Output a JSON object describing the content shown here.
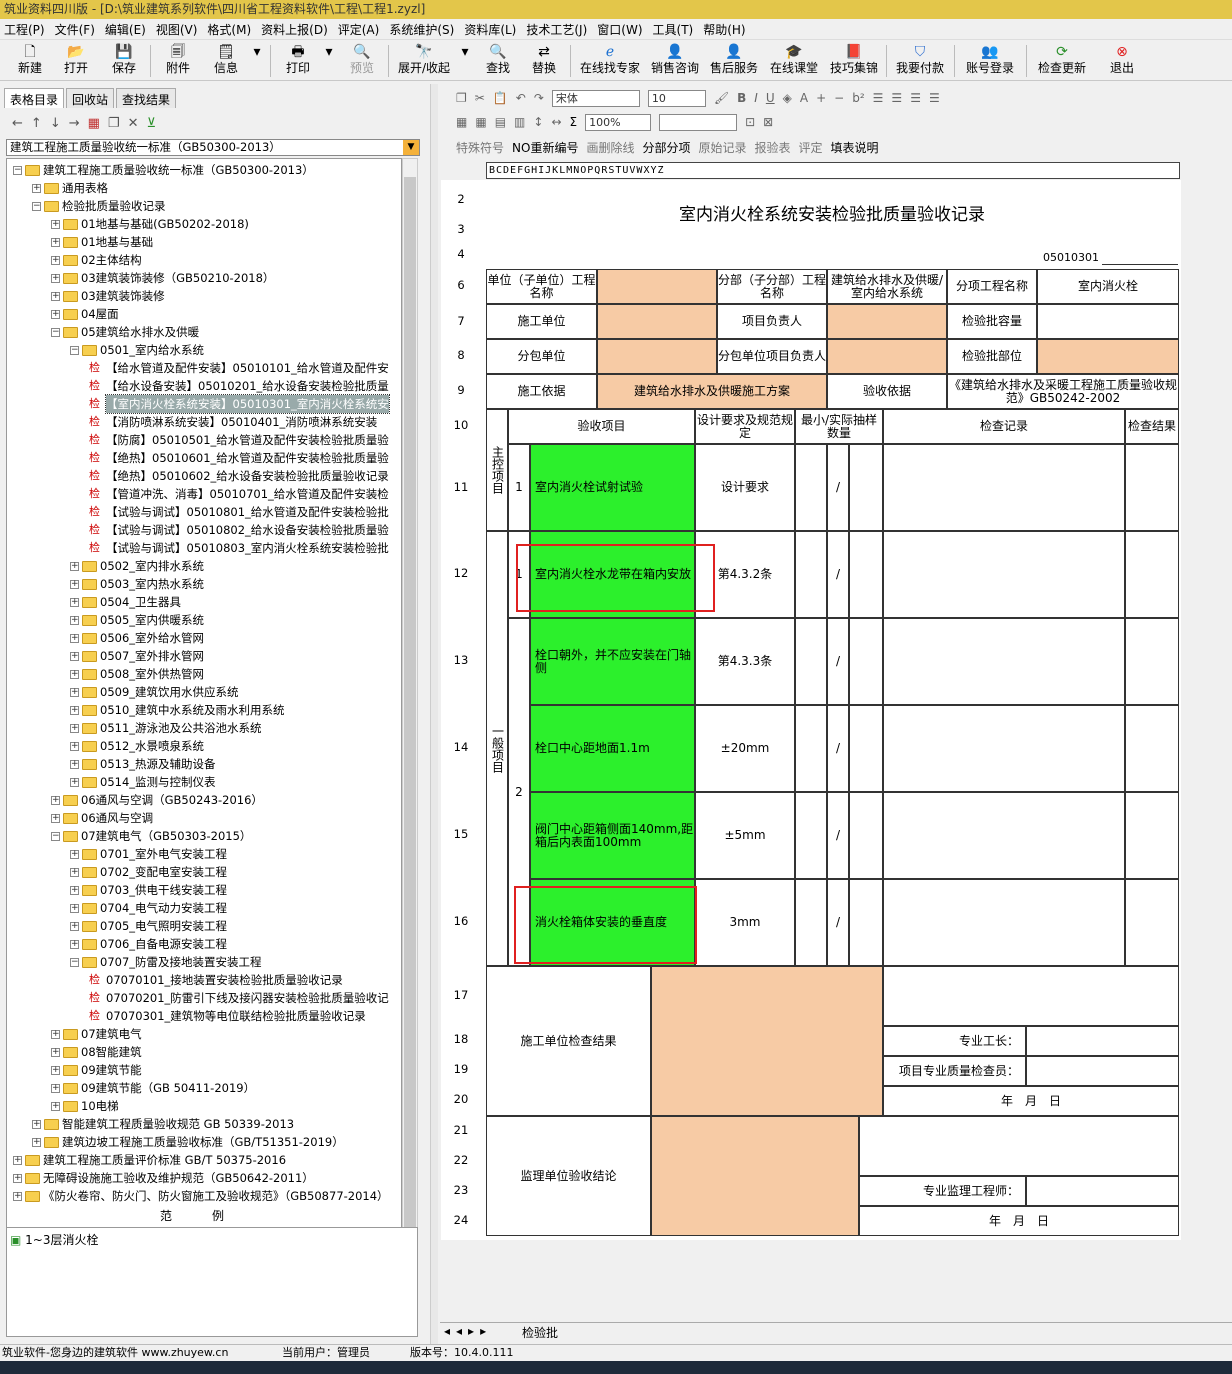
{
  "window": {
    "title": "筑业资料四川版 - [D:\\筑业建筑系列软件\\四川省工程资料软件\\工程\\工程1.zyzl]"
  },
  "menu": [
    "工程(P)",
    "文件(F)",
    "编辑(E)",
    "视图(V)",
    "格式(M)",
    "资料上报(D)",
    "评定(A)",
    "系统维护(S)",
    "资料库(L)",
    "技术工艺(J)",
    "窗口(W)",
    "工具(T)",
    "帮助(H)"
  ],
  "toolbar": {
    "new": "新建",
    "open": "打开",
    "save": "保存",
    "attach": "附件",
    "info": "信息",
    "print": "打印",
    "preview": "预览",
    "expand": "展开/收起",
    "find": "查找",
    "replace": "替换",
    "expert": "在线找专家",
    "consult": "销售咨询",
    "service": "售后服务",
    "course": "在线课堂",
    "tips": "技巧集锦",
    "pay": "我要付款",
    "login": "账号登录",
    "update": "检查更新",
    "exit": "退出"
  },
  "left_tabs": [
    "表格目录",
    "回收站",
    "查找结果"
  ],
  "std_select": "建筑工程施工质量验收统一标准（GB50300-2013）",
  "tree": [
    {
      "d": 0,
      "t": "建筑工程施工质量验收统一标准（GB50300-2013）",
      "k": "o"
    },
    {
      "d": 1,
      "t": "通用表格",
      "k": "f"
    },
    {
      "d": 1,
      "t": "检验批质量验收记录",
      "k": "o"
    },
    {
      "d": 2,
      "t": "01地基与基础(GB50202-2018)",
      "k": "f"
    },
    {
      "d": 2,
      "t": "01地基与基础",
      "k": "f"
    },
    {
      "d": 2,
      "t": "02主体结构",
      "k": "f"
    },
    {
      "d": 2,
      "t": "03建筑装饰装修（GB50210-2018）",
      "k": "f"
    },
    {
      "d": 2,
      "t": "03建筑装饰装修",
      "k": "f"
    },
    {
      "d": 2,
      "t": "04屋面",
      "k": "f"
    },
    {
      "d": 2,
      "t": "05建筑给水排水及供暖",
      "k": "o"
    },
    {
      "d": 3,
      "t": "0501_室内给水系统",
      "k": "o"
    },
    {
      "d": 4,
      "t": "【给水管道及配件安装】05010101_给水管道及配件安",
      "k": "j"
    },
    {
      "d": 4,
      "t": "【给水设备安装】05010201_给水设备安装检验批质量",
      "k": "j"
    },
    {
      "d": 4,
      "t": "【室内消火栓系统安装】05010301_室内消火栓系统安",
      "k": "js"
    },
    {
      "d": 4,
      "t": "【消防喷淋系统安装】05010401_消防喷淋系统安装",
      "k": "j"
    },
    {
      "d": 4,
      "t": "【防腐】05010501_给水管道及配件安装检验批质量验",
      "k": "j"
    },
    {
      "d": 4,
      "t": "【绝热】05010601_给水管道及配件安装检验批质量验",
      "k": "j"
    },
    {
      "d": 4,
      "t": "【绝热】05010602_给水设备安装检验批质量验收记录",
      "k": "j"
    },
    {
      "d": 4,
      "t": "【管道冲洗、消毒】05010701_给水管道及配件安装检",
      "k": "j"
    },
    {
      "d": 4,
      "t": "【试验与调试】05010801_给水管道及配件安装检验批",
      "k": "j"
    },
    {
      "d": 4,
      "t": "【试验与调试】05010802_给水设备安装检验批质量验",
      "k": "j"
    },
    {
      "d": 4,
      "t": "【试验与调试】05010803_室内消火栓系统安装检验批",
      "k": "j"
    },
    {
      "d": 3,
      "t": "0502_室内排水系统",
      "k": "f"
    },
    {
      "d": 3,
      "t": "0503_室内热水系统",
      "k": "f"
    },
    {
      "d": 3,
      "t": "0504_卫生器具",
      "k": "f"
    },
    {
      "d": 3,
      "t": "0505_室内供暖系统",
      "k": "f"
    },
    {
      "d": 3,
      "t": "0506_室外给水管网",
      "k": "f"
    },
    {
      "d": 3,
      "t": "0507_室外排水管网",
      "k": "f"
    },
    {
      "d": 3,
      "t": "0508_室外供热管网",
      "k": "f"
    },
    {
      "d": 3,
      "t": "0509_建筑饮用水供应系统",
      "k": "f"
    },
    {
      "d": 3,
      "t": "0510_建筑中水系统及雨水利用系统",
      "k": "f"
    },
    {
      "d": 3,
      "t": "0511_游泳池及公共浴池水系统",
      "k": "f"
    },
    {
      "d": 3,
      "t": "0512_水景喷泉系统",
      "k": "f"
    },
    {
      "d": 3,
      "t": "0513_热源及辅助设备",
      "k": "f"
    },
    {
      "d": 3,
      "t": "0514_监测与控制仪表",
      "k": "f"
    },
    {
      "d": 2,
      "t": "06通风与空调（GB50243-2016）",
      "k": "f"
    },
    {
      "d": 2,
      "t": "06通风与空调",
      "k": "f"
    },
    {
      "d": 2,
      "t": "07建筑电气（GB50303-2015）",
      "k": "o"
    },
    {
      "d": 3,
      "t": "0701_室外电气安装工程",
      "k": "f"
    },
    {
      "d": 3,
      "t": "0702_变配电室安装工程",
      "k": "f"
    },
    {
      "d": 3,
      "t": "0703_供电干线安装工程",
      "k": "f"
    },
    {
      "d": 3,
      "t": "0704_电气动力安装工程",
      "k": "f"
    },
    {
      "d": 3,
      "t": "0705_电气照明安装工程",
      "k": "f"
    },
    {
      "d": 3,
      "t": "0706_自备电源安装工程",
      "k": "f"
    },
    {
      "d": 3,
      "t": "0707_防雷及接地装置安装工程",
      "k": "o"
    },
    {
      "d": 4,
      "t": "07070101_接地装置安装检验批质量验收记录",
      "k": "j"
    },
    {
      "d": 4,
      "t": "07070201_防雷引下线及接闪器安装检验批质量验收记",
      "k": "j"
    },
    {
      "d": 4,
      "t": "07070301_建筑物等电位联结检验批质量验收记录",
      "k": "j"
    },
    {
      "d": 2,
      "t": "07建筑电气",
      "k": "f"
    },
    {
      "d": 2,
      "t": "08智能建筑",
      "k": "f"
    },
    {
      "d": 2,
      "t": "09建筑节能",
      "k": "f"
    },
    {
      "d": 2,
      "t": "09建筑节能（GB 50411-2019）",
      "k": "f"
    },
    {
      "d": 2,
      "t": "10电梯",
      "k": "f"
    },
    {
      "d": 1,
      "t": "智能建筑工程质量验收规范 GB 50339-2013",
      "k": "f"
    },
    {
      "d": 1,
      "t": "建筑边坡工程施工质量验收标准（GB/T51351-2019）",
      "k": "f"
    },
    {
      "d": 0,
      "t": "建筑工程施工质量评价标准 GB/T 50375-2016",
      "k": "f"
    },
    {
      "d": 0,
      "t": "无障碍设施施工验收及维护规范（GB50642-2011）",
      "k": "f"
    },
    {
      "d": 0,
      "t": "《防火卷帘、防火门、防火窗施工及验收规范》（GB50877-2014）",
      "k": "f"
    }
  ],
  "example_header": "范例",
  "example_item": "1~3层消火栓",
  "rt1": [
    "宋体",
    "10",
    "100%"
  ],
  "rt3": {
    "special": "特殊符号",
    "renumber": "NO重新编号",
    "delete_line": "画删除线",
    "item_split": "分部分项",
    "orig": "原始记录",
    "report": "报验表",
    "eval": "评定",
    "fill_help": "填表说明"
  },
  "col_header": "BCDEFGHIJKLMNOPQRSTUVWXYZ",
  "form": {
    "title": "室内消火栓系统安装检验批质量验收记录",
    "code": "05010301",
    "unit_label": "单位（子单位）工程名称",
    "sub_label": "分部（子分部）工程名称",
    "sub_val": "建筑给水排水及供暖/室内给水系统",
    "item_label": "分项工程名称",
    "item_val": "室内消火栓",
    "constr_label": "施工单位",
    "pm_label": "项目负责人",
    "cap_label": "检验批容量",
    "subc_label": "分包单位",
    "subpm_label": "分包单位项目负责人",
    "part_label": "检验批部位",
    "basis_label": "施工依据",
    "basis_val": "建筑给水排水及供暖施工方案",
    "acc_label": "验收依据",
    "acc_val": "《建筑给水排水及采暖工程施工质量验收规范》GB50242-2002",
    "h_item": "验收项目",
    "h_design": "设计要求及规范规定",
    "h_min": "最小/实际抽样数量",
    "h_record": "检查记录",
    "h_result": "检查结果",
    "main_label": "主控项目",
    "general_label": "一般项目",
    "rows": [
      {
        "n": "1",
        "item": "室内消火栓试射试验",
        "req": "设计要求",
        "slash": "/"
      },
      {
        "n": "1",
        "item": "室内消火栓水龙带在箱内安放",
        "req": "第4.3.2条",
        "slash": "/"
      },
      {
        "n": "",
        "item": "栓口朝外，并不应安装在门轴侧",
        "req": "第4.3.3条",
        "slash": "/"
      },
      {
        "n": "",
        "item": "栓口中心距地面1.1m",
        "req": "±20mm",
        "slash": "/"
      },
      {
        "n": "",
        "item": "阀门中心距箱侧面140mm,距箱后内表面100mm",
        "req": "±5mm",
        "slash": "/"
      },
      {
        "n": "",
        "item": "消火栓箱体安装的垂直度",
        "req": "3mm",
        "slash": "/"
      }
    ],
    "general_n": "2",
    "constr_result": "施工单位检查结果",
    "foreman": "专业工长：",
    "inspector": "项目专业质量检查员：",
    "date": "年　月　日",
    "sup_result": "监理单位验收结论",
    "sup_eng": "专业监理工程师：",
    "row_nums": [
      "2",
      "3",
      "4",
      "6",
      "7",
      "8",
      "9",
      "10",
      "11",
      "12",
      "13",
      "14",
      "15",
      "16",
      "17",
      "18",
      "19",
      "20",
      "21",
      "22",
      "23",
      "24"
    ]
  },
  "sheet_tab": "检验批",
  "status": {
    "company": "筑业软件-您身边的建筑软件 www.zhuyew.cn",
    "user": "当前用户：管理员",
    "version": "版本号：10.4.0.111"
  }
}
